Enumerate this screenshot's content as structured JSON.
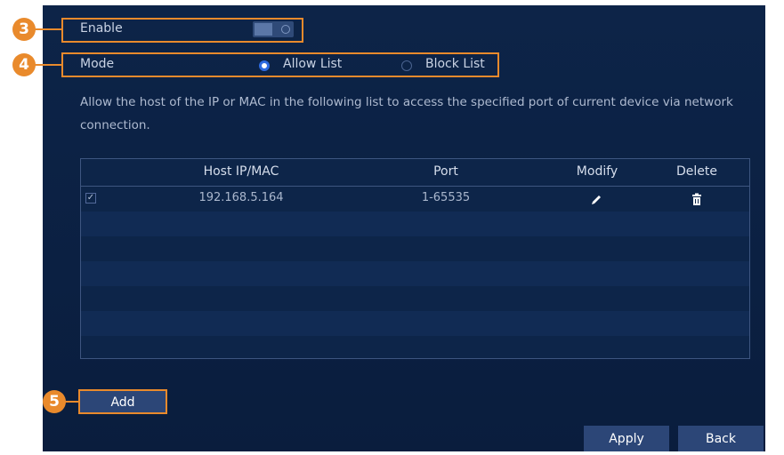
{
  "enable": {
    "label": "Enable",
    "toggle_state": "off"
  },
  "mode": {
    "label": "Mode",
    "options": [
      {
        "label": "Allow List",
        "selected": true
      },
      {
        "label": "Block List",
        "selected": false
      }
    ]
  },
  "description": "Allow the host of the IP or MAC in the following list to access the specified port of current device via network connection.",
  "table": {
    "columns": [
      "Host IP/MAC",
      "Port",
      "Modify",
      "Delete"
    ],
    "rows": [
      {
        "checked": true,
        "checkmark": "✓",
        "host": "192.168.5.164",
        "port": "1-65535",
        "modify_icon": "pencil-icon",
        "delete_icon": "trash-icon"
      }
    ]
  },
  "buttons": {
    "add": "Add",
    "apply": "Apply",
    "back": "Back"
  },
  "callouts": [
    "3",
    "4",
    "5"
  ],
  "colors": {
    "panel_bg": "#0b2042",
    "callout": "#e98a2c",
    "radio_selected": "#2d6ae0",
    "button_bg": "#2c4677"
  }
}
